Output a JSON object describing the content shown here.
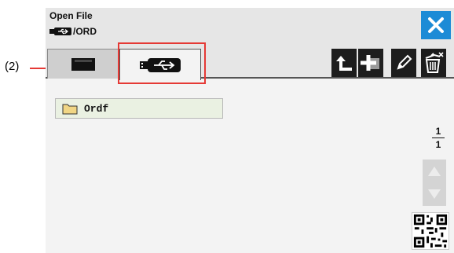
{
  "annotation": {
    "label": "(2)",
    "color": "#e53935"
  },
  "dialog": {
    "title": "Open File",
    "path": "/ORD",
    "close_icon": "close-x-icon",
    "accent": "#1c8bd6"
  },
  "tabs": [
    {
      "name": "internal-memory",
      "icon": "memory-card-icon",
      "selected": false
    },
    {
      "name": "usb",
      "icon": "usb-drive-icon",
      "selected": true
    }
  ],
  "toolbar": [
    {
      "name": "up-folder",
      "icon": "arrow-up-left-icon"
    },
    {
      "name": "new-folder",
      "icon": "new-folder-icon"
    },
    {
      "name": "rename",
      "icon": "pencil-icon"
    },
    {
      "name": "delete",
      "icon": "trash-icon"
    }
  ],
  "files": [
    {
      "label": "Ordf",
      "icon": "folder-icon"
    }
  ],
  "pagination": {
    "current": "1",
    "total": "1"
  },
  "scroll": {
    "up_icon": "triangle-up-icon",
    "down_icon": "triangle-down-icon"
  },
  "qr": {
    "icon": "qr-code-icon"
  }
}
